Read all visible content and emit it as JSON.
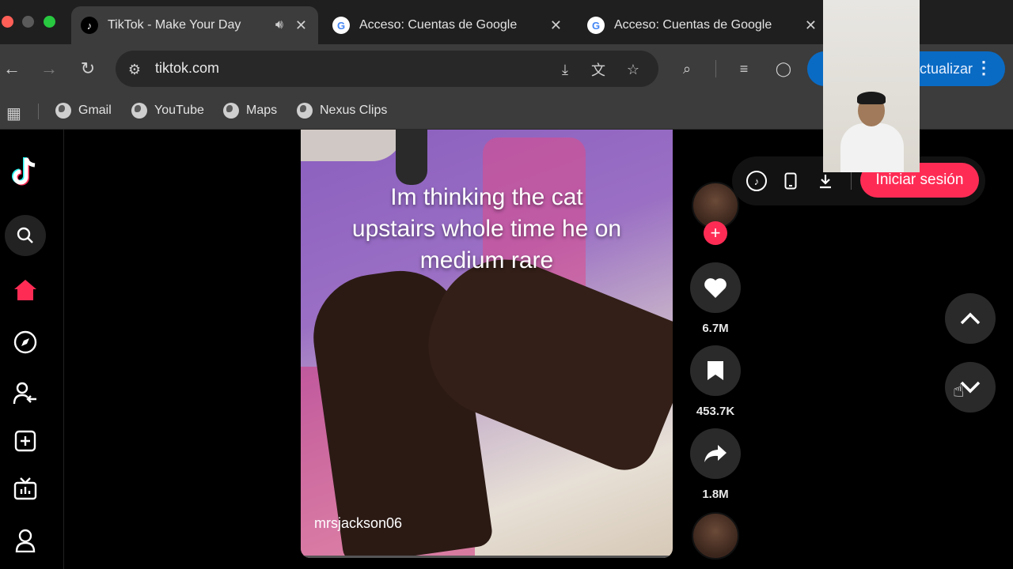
{
  "browser": {
    "tabs": [
      {
        "title": "TikTok - Make Your Day",
        "active": true,
        "favicon": "tiktok-icon"
      },
      {
        "title": "Acceso: Cuentas de Google",
        "active": false,
        "favicon": "google-icon"
      },
      {
        "title": "Acceso: Cuentas de Google",
        "active": false,
        "favicon": "google-icon"
      }
    ],
    "url": "tiktok.com",
    "update_label": "ctualizar",
    "bookmarks": [
      "Gmail",
      "YouTube",
      "Maps",
      "Nexus Clips"
    ]
  },
  "video": {
    "caption_lines": [
      "Im thinking the cat",
      "upstairs whole time he on",
      "medium rare"
    ],
    "author": "mrsjackson06"
  },
  "actions": {
    "likes": "6.7M",
    "saves": "453.7K",
    "shares": "1.8M"
  },
  "floating_bar": {
    "login_label": "Iniciar sesión"
  },
  "colors": {
    "accent": "#fe2c55",
    "update_blue": "#0a6bc4"
  }
}
